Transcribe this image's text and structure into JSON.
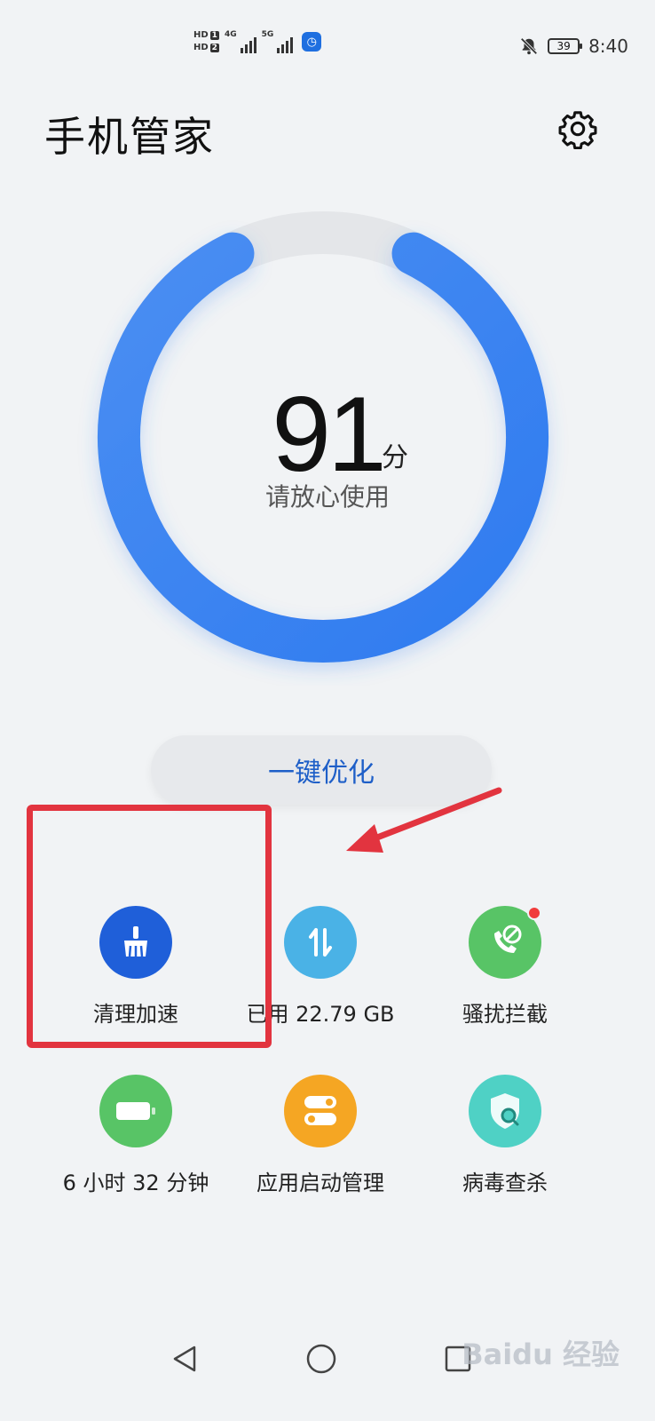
{
  "status_bar": {
    "hd1": "HD",
    "hd1_num": "1",
    "hd2": "HD",
    "hd2_num": "2",
    "network1": "4G",
    "network2": "5G",
    "battery": "39",
    "time": "8:40"
  },
  "header": {
    "title": "手机管家"
  },
  "score": {
    "value": "91",
    "unit": "分",
    "subtitle": "请放心使用",
    "fraction": 0.91,
    "color": "#3a86f0"
  },
  "optimize_button": {
    "label": "一键优化"
  },
  "tools": [
    {
      "label": "清理加速",
      "icon": "broom-icon",
      "color": "#1f5fd9"
    },
    {
      "label": "已用 22.79 GB",
      "icon": "data-transfer-icon",
      "color": "#4ab2e6"
    },
    {
      "label": "骚扰拦截",
      "icon": "phone-block-icon",
      "color": "#58c466"
    },
    {
      "label": "6 小时 32 分钟",
      "icon": "battery-icon",
      "color": "#58c466"
    },
    {
      "label": "应用启动管理",
      "icon": "toggle-icon",
      "color": "#f5a623"
    },
    {
      "label": "病毒查杀",
      "icon": "shield-search-icon",
      "color": "#4fd1c5"
    }
  ],
  "watermark": "Baidu 经验"
}
